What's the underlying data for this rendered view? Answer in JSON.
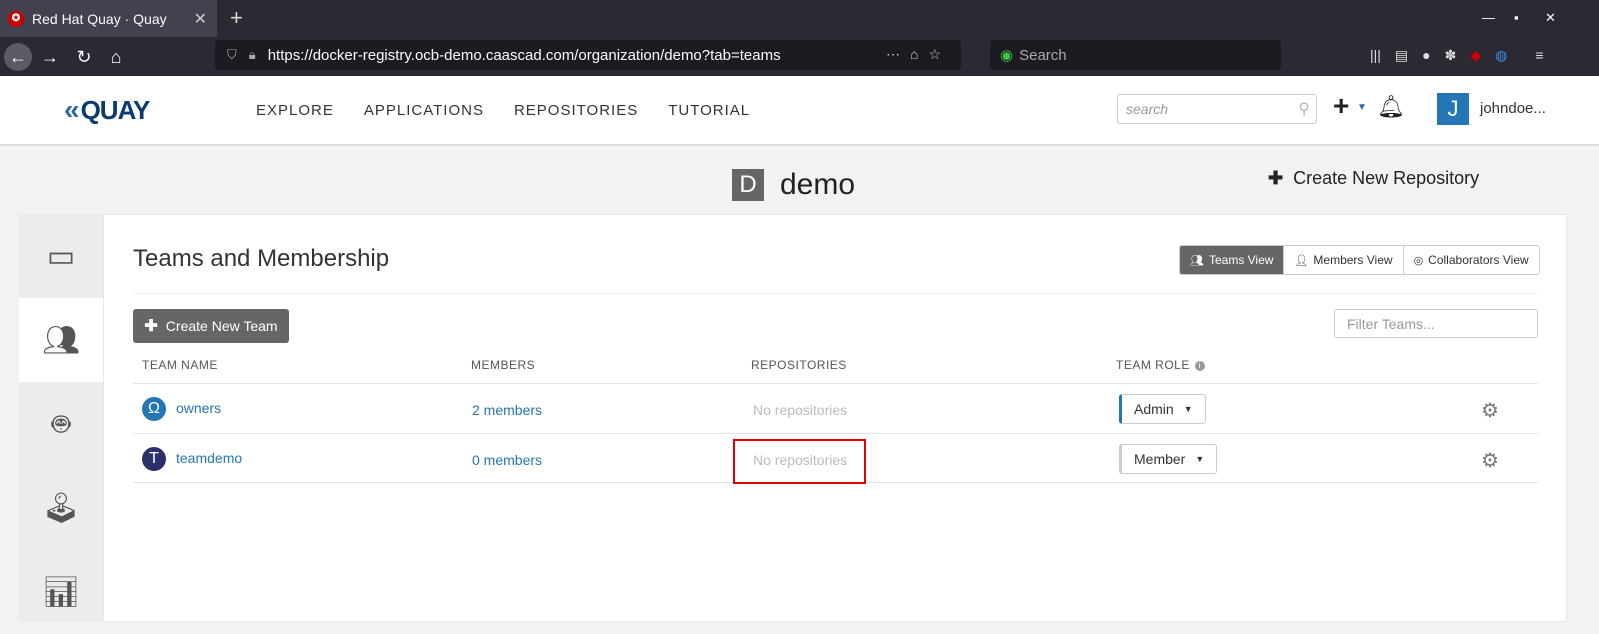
{
  "browser": {
    "tab_title": "Red Hat Quay · Quay",
    "url": "https://docker-registry.ocb-demo.caascad.com/organization/demo?tab=teams",
    "search_placeholder": "Search"
  },
  "header": {
    "logo": "QUAY",
    "nav": [
      "EXPLORE",
      "APPLICATIONS",
      "REPOSITORIES",
      "TUTORIAL"
    ],
    "search_placeholder": "search",
    "avatar_letter": "J",
    "username": "johndoe..."
  },
  "org": {
    "avatar_letter": "D",
    "name": "demo",
    "create_repo": "Create New Repository"
  },
  "teams": {
    "title": "Teams and Membership",
    "views": [
      "Teams View",
      "Members View",
      "Collaborators View"
    ],
    "create_team": "Create New Team",
    "filter_placeholder": "Filter Teams...",
    "columns": [
      "TEAM NAME",
      "MEMBERS",
      "REPOSITORIES",
      "TEAM ROLE"
    ],
    "rows": [
      {
        "avatar": "Ω",
        "name": "owners",
        "members": "2 members",
        "repos": "No repositories",
        "role": "Admin",
        "color": "#2576b5"
      },
      {
        "avatar": "T",
        "name": "teamdemo",
        "members": "0 members",
        "repos": "No repositories",
        "role": "Member",
        "color": "#2d2f6b"
      }
    ]
  }
}
